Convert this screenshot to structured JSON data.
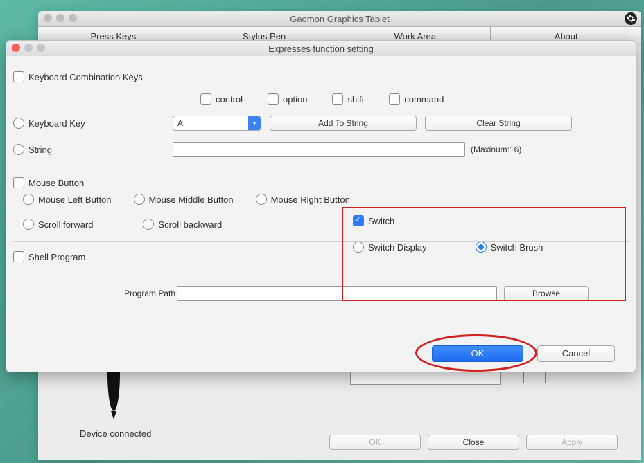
{
  "main": {
    "title": "Gaomon Graphics Tablet",
    "tabs": [
      "Press Keys",
      "Stylus Pen",
      "Work Area",
      "About"
    ],
    "status": "Device connected",
    "buttons": {
      "ok": "OK",
      "close": "Close",
      "apply": "Apply"
    }
  },
  "dialog": {
    "title": "Expresses function setting",
    "kbd_combo": "Keyboard Combination Keys",
    "mods": {
      "control": "control",
      "option": "option",
      "shift": "shift",
      "command": "command"
    },
    "kbd_key": "Keyboard Key",
    "key_select_value": "A",
    "add_to_string": "Add To String",
    "clear_string": "Clear String",
    "string_label": "String",
    "string_max": "(Maxinum:16)",
    "mouse_button": "Mouse Button",
    "mouse": {
      "left": "Mouse Left Button",
      "middle": "Mouse Middle Button",
      "right": "Mouse Right Button",
      "fwd": "Scroll forward",
      "back": "Scroll backward"
    },
    "switch": {
      "label": "Switch",
      "display": "Switch Display",
      "brush": "Switch Brush"
    },
    "shell": "Shell Program",
    "program_path": "Program Path",
    "browse": "Browse",
    "ok": "OK",
    "cancel": "Cancel"
  }
}
